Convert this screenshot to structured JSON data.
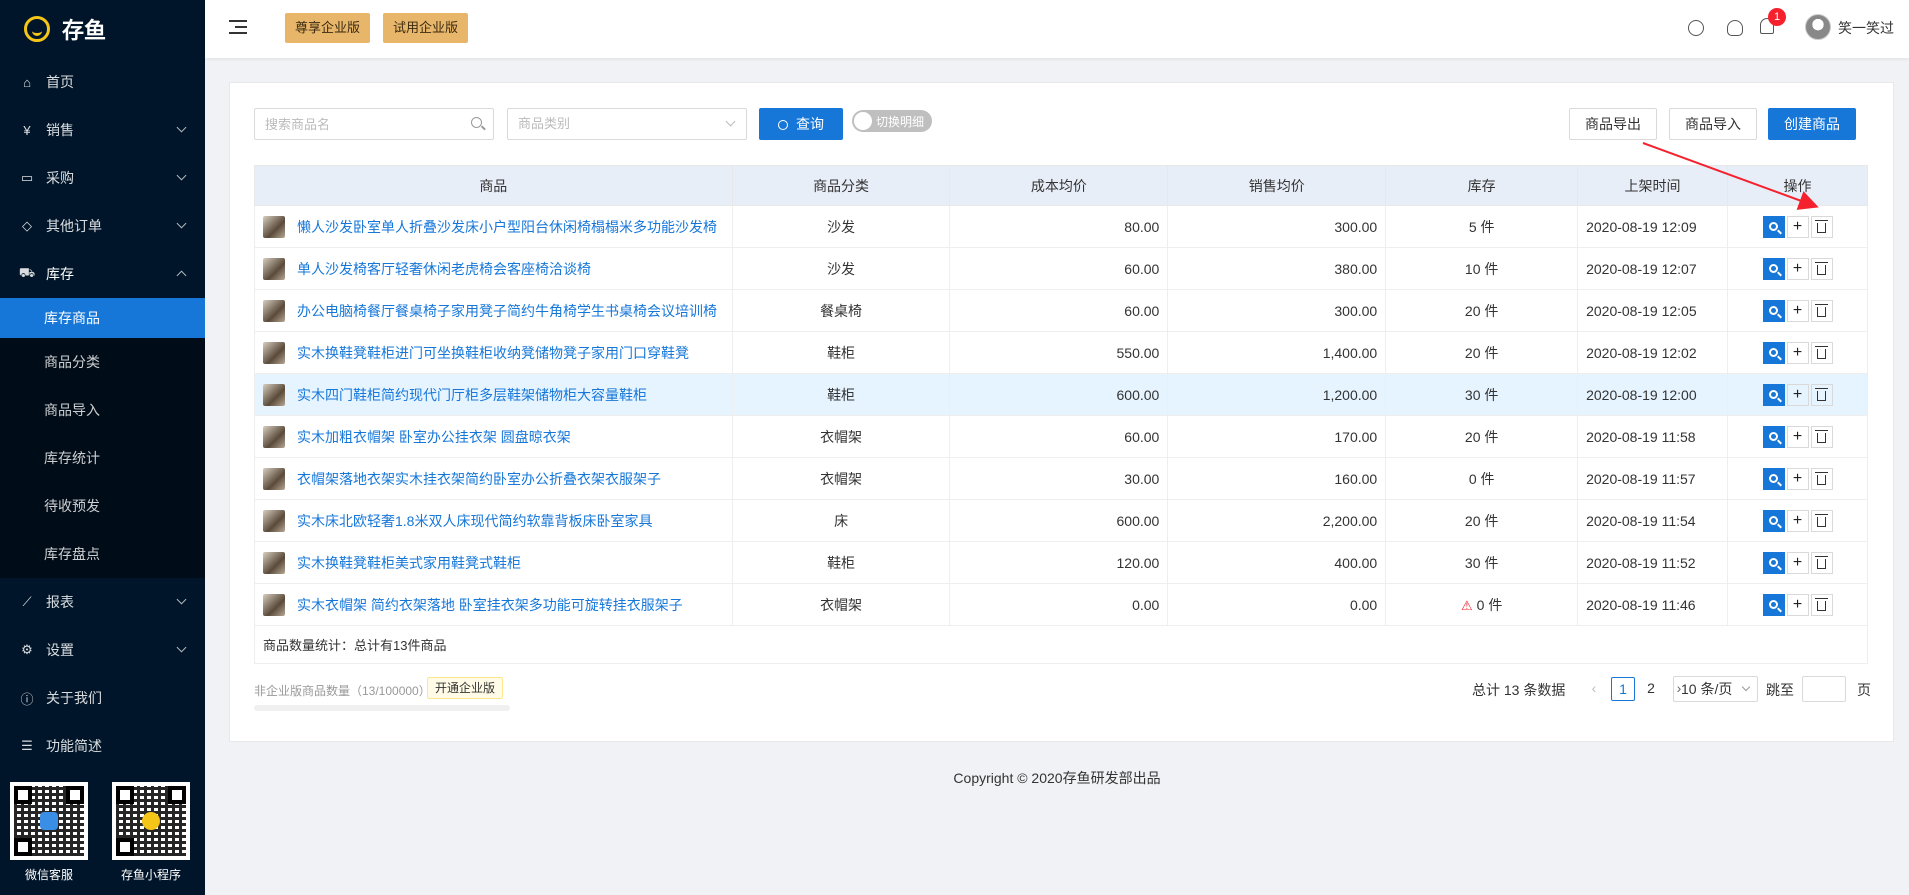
{
  "brand": {
    "name": "存鱼"
  },
  "sidebar": {
    "items": [
      {
        "label": "首页",
        "icon": "home-icon",
        "expandable": false
      },
      {
        "label": "销售",
        "icon": "yen-icon",
        "expandable": true
      },
      {
        "label": "采购",
        "icon": "bag-icon",
        "expandable": true
      },
      {
        "label": "其他订单",
        "icon": "tag-icon",
        "expandable": true
      },
      {
        "label": "库存",
        "icon": "cart-icon",
        "expandable": true,
        "open": true
      },
      {
        "label": "报表",
        "icon": "chart-icon",
        "expandable": true
      },
      {
        "label": "设置",
        "icon": "gear-icon",
        "expandable": true
      },
      {
        "label": "关于我们",
        "icon": "info-icon",
        "expandable": false
      },
      {
        "label": "功能简述",
        "icon": "list-icon",
        "expandable": false
      }
    ],
    "submenu": [
      "库存商品",
      "商品分类",
      "商品导入",
      "库存统计",
      "待收预发",
      "库存盘点"
    ],
    "active_submenu": "库存商品",
    "qr": [
      {
        "label": "微信客服",
        "center_color": "#3a8ee6"
      },
      {
        "label": "存鱼小程序",
        "center_color": "#f5c518"
      }
    ]
  },
  "header": {
    "ent_btn_1": "尊享企业版",
    "ent_btn_2": "试用企业版",
    "notification_count": "1",
    "username": "笑一笑过"
  },
  "toolbar": {
    "search_placeholder": "搜索商品名",
    "category_placeholder": "商品类别",
    "query_label": "查询",
    "toggle_label": "切换明细",
    "export_label": "商品导出",
    "import_label": "商品导入",
    "create_label": "创建商品"
  },
  "table": {
    "headers": [
      "商品",
      "商品分类",
      "成本均价",
      "销售均价",
      "库存",
      "上架时间",
      "操作"
    ],
    "rows": [
      {
        "name": "懒人沙发卧室单人折叠沙发床小户型阳台休闲椅榻榻米多功能沙发椅",
        "category": "沙发",
        "cost": "80.00",
        "price": "300.00",
        "stock": "5 件",
        "time": "2020-08-19 12:09",
        "warn": false
      },
      {
        "name": "单人沙发椅客厅轻奢休闲老虎椅会客座椅洽谈椅",
        "category": "沙发",
        "cost": "60.00",
        "price": "380.00",
        "stock": "10 件",
        "time": "2020-08-19 12:07",
        "warn": false
      },
      {
        "name": "办公电脑椅餐厅餐桌椅子家用凳子简约牛角椅学生书桌椅会议培训椅",
        "category": "餐桌椅",
        "cost": "60.00",
        "price": "300.00",
        "stock": "20 件",
        "time": "2020-08-19 12:05",
        "warn": false
      },
      {
        "name": "实木换鞋凳鞋柜进门可坐换鞋柜收纳凳储物凳子家用门口穿鞋凳",
        "category": "鞋柜",
        "cost": "550.00",
        "price": "1,400.00",
        "stock": "20 件",
        "time": "2020-08-19 12:02",
        "warn": false
      },
      {
        "name": "实木四门鞋柜简约现代门厅柜多层鞋架储物柜大容量鞋柜",
        "category": "鞋柜",
        "cost": "600.00",
        "price": "1,200.00",
        "stock": "30 件",
        "time": "2020-08-19 12:00",
        "warn": false
      },
      {
        "name": "实木加粗衣帽架 卧室办公挂衣架 圆盘晾衣架",
        "category": "衣帽架",
        "cost": "60.00",
        "price": "170.00",
        "stock": "20 件",
        "time": "2020-08-19 11:58",
        "warn": false
      },
      {
        "name": "衣帽架落地衣架实木挂衣架简约卧室办公折叠衣架衣服架子",
        "category": "衣帽架",
        "cost": "30.00",
        "price": "160.00",
        "stock": "0 件",
        "time": "2020-08-19 11:57",
        "warn": false
      },
      {
        "name": "实木床北欧轻奢1.8米双人床现代简约软靠背板床卧室家具",
        "category": "床",
        "cost": "600.00",
        "price": "2,200.00",
        "stock": "20 件",
        "time": "2020-08-19 11:54",
        "warn": false
      },
      {
        "name": "实木换鞋凳鞋柜美式家用鞋凳式鞋柜",
        "category": "鞋柜",
        "cost": "120.00",
        "price": "400.00",
        "stock": "30 件",
        "time": "2020-08-19 11:52",
        "warn": false
      },
      {
        "name": "实木衣帽架 简约衣架落地 卧室挂衣架多功能可旋转挂衣服架子",
        "category": "衣帽架",
        "cost": "0.00",
        "price": "0.00",
        "stock": "0 件",
        "time": "2020-08-19 11:46",
        "warn": true
      }
    ],
    "summary": "商品数量统计：总计有13件商品"
  },
  "quota": {
    "text": "非企业版商品数量（13/100000）",
    "button": "开通企业版"
  },
  "pagination": {
    "total": "总计 13 条数据",
    "pages": [
      "1",
      "2"
    ],
    "current": "1",
    "page_size": "10 条/页",
    "jump_label": "跳至",
    "page_suffix": "页"
  },
  "footer": {
    "text": "Copyright © 2020存鱼研发部出品"
  },
  "colors": {
    "primary": "#1677d9",
    "sidebar": "#001529",
    "enterprise": "#e8b66a",
    "annotation_arrow": "#f5222d"
  }
}
